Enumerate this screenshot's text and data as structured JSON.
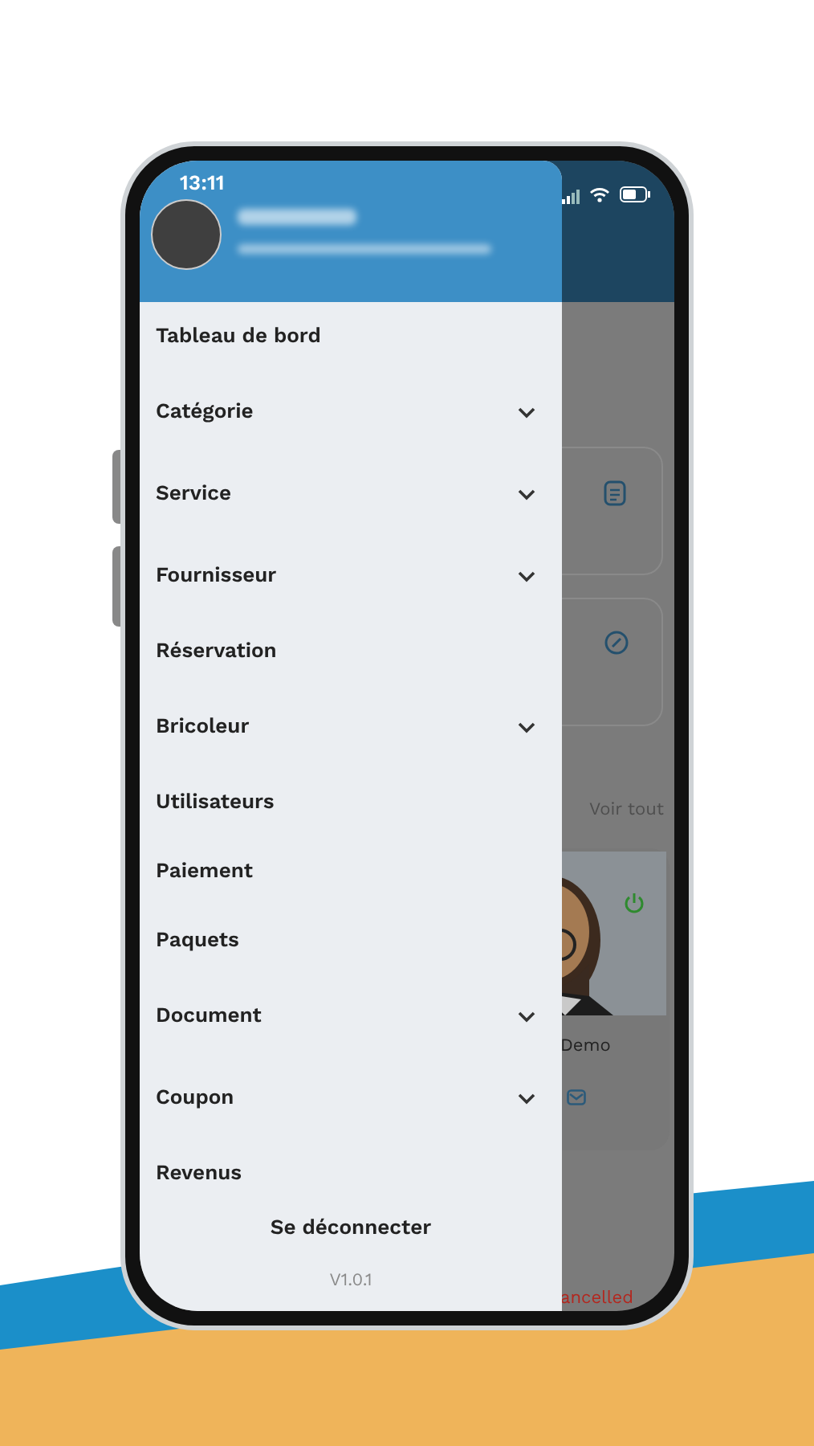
{
  "status_bar": {
    "time": "13:11"
  },
  "drawer": {
    "menu": [
      {
        "label": "Tableau de bord",
        "kind": "link"
      },
      {
        "label": "Catégorie",
        "kind": "group"
      },
      {
        "label": "Service",
        "kind": "group"
      },
      {
        "label": "Fournisseur",
        "kind": "group"
      },
      {
        "label": "Réservation",
        "kind": "link"
      },
      {
        "label": "Bricoleur",
        "kind": "group"
      },
      {
        "label": "Utilisateurs",
        "kind": "link"
      },
      {
        "label": "Paiement",
        "kind": "link"
      },
      {
        "label": "Paquets",
        "kind": "link"
      },
      {
        "label": "Document",
        "kind": "group"
      },
      {
        "label": "Coupon",
        "kind": "group"
      },
      {
        "label": "Revenus",
        "kind": "link"
      }
    ],
    "logout": "Se déconnecter",
    "version": "V1.0.1"
  },
  "background_screen": {
    "see_all": "Voir tout",
    "provider_name": "Demo",
    "booking_status": "ancelled"
  }
}
